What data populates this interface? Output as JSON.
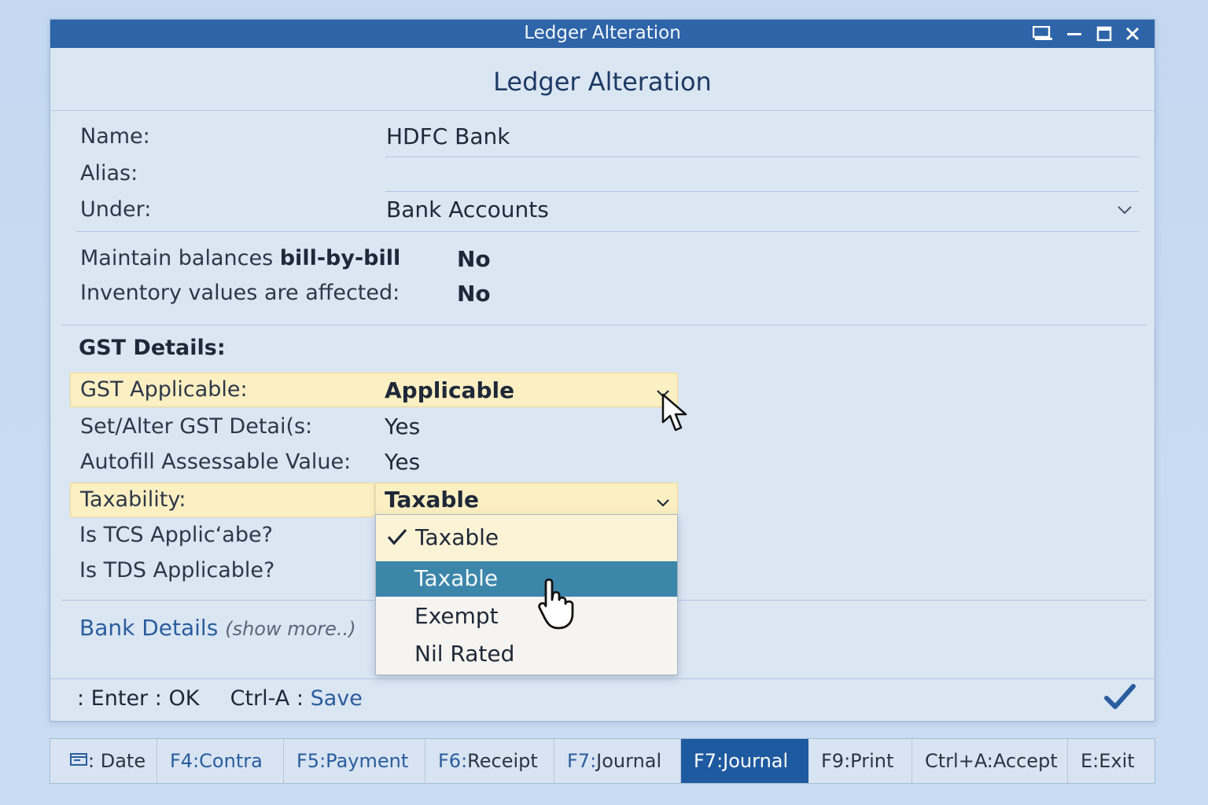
{
  "window": {
    "title": "Ledger Alteration",
    "heading": "Ledger Alteration"
  },
  "fields": {
    "name_label": "Name:",
    "name_value": "HDFC Bank",
    "alias_label": "Alias:",
    "under_label": "Under:",
    "under_value": "Bank Accounts",
    "maintain_label_prefix": "Maintain balances ",
    "maintain_label_bold": "bill-by-bill",
    "maintain_value": "No",
    "inventory_label": "Inventory values are affected:",
    "inventory_value": "No"
  },
  "gst": {
    "section_title": "GST Details:",
    "applicable_label": "GST Applicable:",
    "applicable_value": "Applicable",
    "set_alter_label": "Set/Alter GST Detai(s:",
    "set_alter_value": "Yes",
    "autofill_label": "Autofill Assessable Value:",
    "autofill_value": "Yes",
    "taxability_label": "Taxability:",
    "taxability_value": "Taxable",
    "tcs_label": "Is TCS Applic‘abe?",
    "tds_label": "Is TDS Applicable?"
  },
  "taxability_options": {
    "selected": "Taxable",
    "highlighted": "Taxable",
    "exempt": "Exempt",
    "nil_rated": "Nil Rated"
  },
  "bank_details": {
    "label": "Bank Details",
    "more": "(show more..)"
  },
  "footer": {
    "enter_key": ": Enter",
    "enter_sep": ":",
    "enter_action": "OK",
    "save_key": "Ctrl-A",
    "save_sep": ":",
    "save_action": "Save"
  },
  "function_keys": [
    {
      "key": "",
      "label": ": Date"
    },
    {
      "key": "F4:",
      "label": " Contra"
    },
    {
      "key": "F5:",
      "label": " Payment"
    },
    {
      "key": "F6:",
      "label": " Receipt"
    },
    {
      "key": "F7:",
      "label": " Journal"
    },
    {
      "key": "F7:",
      "label": " Journal"
    },
    {
      "key": "F9:",
      "label": " Print"
    },
    {
      "key": "Ctrl+A:",
      "label": " Accept"
    },
    {
      "key": "E:",
      "label": " Exit"
    }
  ],
  "colors": {
    "titlebar": "#2e64a8",
    "highlight_row": "#fcefc2",
    "selected_option": "#3c86aa",
    "active_fkey": "#1e5aa0",
    "link": "#2a5d9e"
  },
  "icons": {
    "titlebar": [
      "restore-icon",
      "minimize-icon",
      "maximize-icon",
      "close-icon"
    ],
    "cursor": "arrow-cursor-icon",
    "hand": "hand-cursor-icon",
    "accept": "checkmark-icon"
  }
}
